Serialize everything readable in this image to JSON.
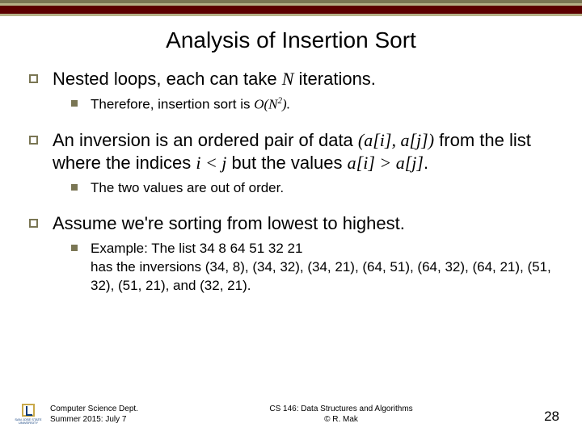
{
  "title": "Analysis of Insertion Sort",
  "bullets": {
    "b1": {
      "text_lead": "Nested loops, each can take ",
      "text_var": "N",
      "text_tail": " iterations.",
      "sub_lead": "Therefore, insertion sort is ",
      "sub_ovar": "O",
      "sub_open": "(",
      "sub_nvar": "N",
      "sub_sup": "2",
      "sub_close": ").",
      "sub_tail": ""
    },
    "b2": {
      "p1": "An ",
      "inv": "inversion",
      "p2": " is an ordered pair of data ",
      "pair_open": "(",
      "ai": "a",
      "br_open1": "[",
      "i1": "i",
      "br_close1": "]",
      "comma": ", ",
      "aj": "a",
      "br_open2": "[",
      "j1": "j",
      "br_close2": "]",
      "pair_close": ")",
      "p3": " from the list where the indices ",
      "ilt": "i < j",
      "p4": " but the values ",
      "aigt": "a",
      "br_open3": "[",
      "i2": "i",
      "br_close3": "]",
      "gt": " > ",
      "aj2": "a",
      "br_open4": "[",
      "j2": "j",
      "br_close4": "]",
      "dot": ".",
      "sub": "The two values are out of order."
    },
    "b3": {
      "text": "Assume we're sorting from lowest to highest.",
      "sub_line1": "Example: The list  34  8  64  51  32  21",
      "sub_line2": "has the inversions (34, 8), (34, 32), (34, 21), (64, 51), (64, 32), (64, 21), (51, 32), (51, 21), and (32, 21)."
    }
  },
  "footer": {
    "dept": "Computer Science Dept.",
    "term": "Summer 2015: July 7",
    "course": "CS 146: Data Structures and Algorithms",
    "copy": "© R. Mak",
    "page": "28",
    "logo_text1": "SAN JOSE STATE",
    "logo_text2": "UNIVERSITY"
  }
}
